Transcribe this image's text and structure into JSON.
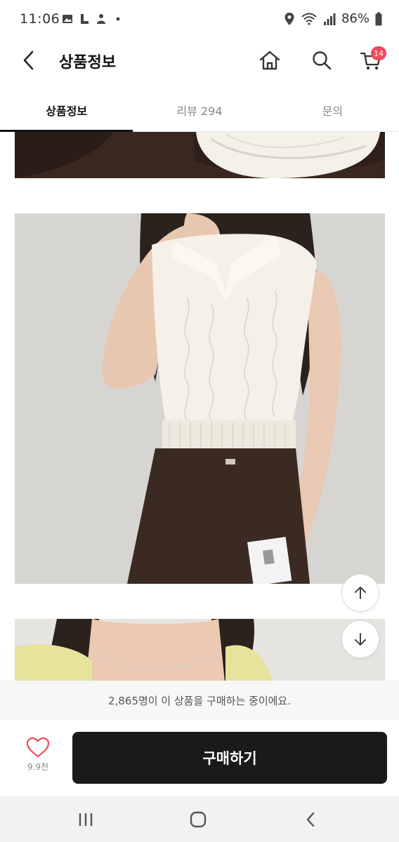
{
  "status_bar": {
    "time": "11:06",
    "battery": "86%"
  },
  "header": {
    "title": "상품정보",
    "cart_badge": "14"
  },
  "tabs": [
    {
      "label": "상품정보",
      "active": true
    },
    {
      "label": "리뷰 294",
      "active": false
    },
    {
      "label": "문의",
      "active": false
    }
  ],
  "notice": {
    "text": "2,865명이 이 상품을 구매하는 중이에요."
  },
  "purchase": {
    "wish_count": "9.9천",
    "buy_label": "구매하기"
  },
  "colors": {
    "accent": "#f04a5c",
    "buy_button": "#1a1a1a"
  }
}
